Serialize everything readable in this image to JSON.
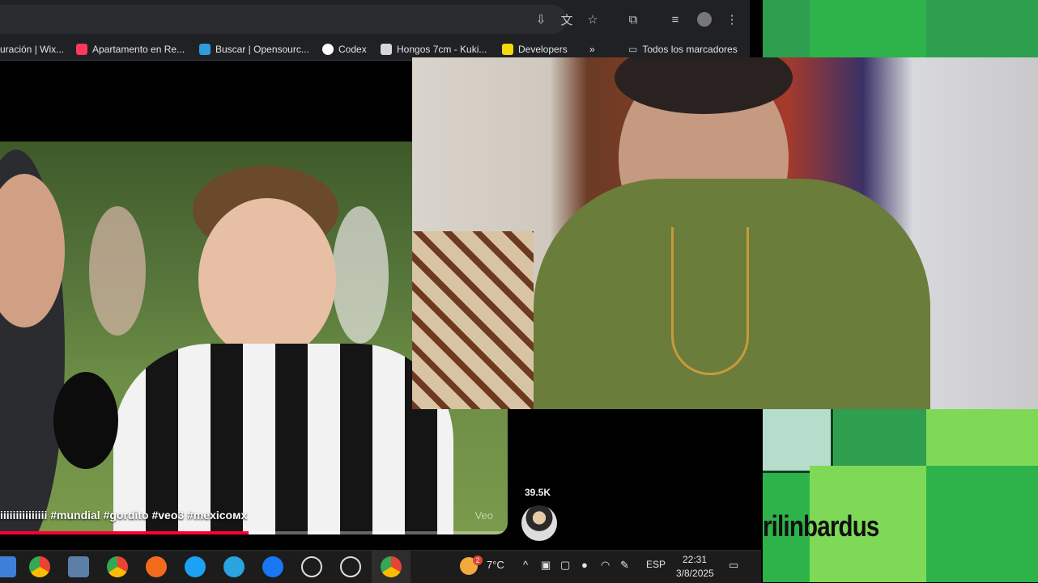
{
  "toolbar": {
    "icons": [
      "install-icon",
      "translate-icon",
      "star-icon",
      "extensions-icon",
      "media-control-icon",
      "profile-icon",
      "menu-icon"
    ]
  },
  "bookmarks": {
    "items": [
      {
        "label": "uración | Wix...",
        "color": "#1a1a1a"
      },
      {
        "label": "Apartamento en Re...",
        "color": "#ff385c"
      },
      {
        "label": "Buscar | Opensourc...",
        "color": "#2d9cdb"
      },
      {
        "label": "Codex",
        "color": "#ffffff"
      },
      {
        "label": "Hongos 7cm - Kuki...",
        "color": "#d7d7d7"
      },
      {
        "label": "Developers",
        "color": "#f5d90a"
      }
    ],
    "more": "»",
    "all_bookmarks": "Todos los marcadores"
  },
  "video": {
    "caption": "iiiiiiiiiiiiiii #mundial #gordito #veo3 #mexicoᴍx",
    "watermark": "Veo",
    "progress": 0.49
  },
  "sidebar": {
    "like_count": "39.5K"
  },
  "overlay": {
    "streamer_name": "rilinbardus",
    "colors": {
      "dark_green": "#2e9e4f",
      "light_green": "#7ed957",
      "mid_green": "#2db34a",
      "pale": "#b6dccb"
    }
  },
  "taskbar": {
    "weather": "7°C",
    "language": "ESP",
    "time": "22:31",
    "date": "3/8/2025",
    "weather_badge": "2"
  }
}
